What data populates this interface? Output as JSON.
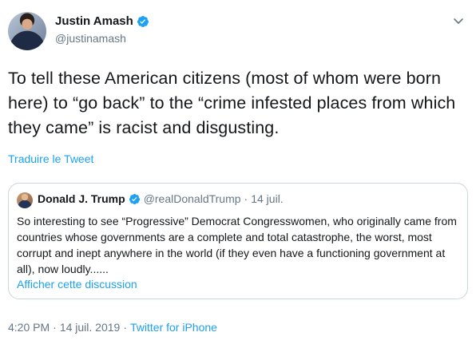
{
  "author": {
    "name": "Justin Amash",
    "handle": "@justinamash"
  },
  "tweet": {
    "text": "To tell these American citizens (most of whom were born here) to “go back” to the “crime infested places from which they came” is racist and disgusting.",
    "translate_label": "Traduire le Tweet"
  },
  "quoted": {
    "name": "Donald J. Trump",
    "handle": "@realDonaldTrump",
    "separator": "·",
    "date": "14 juil.",
    "text": "So interesting to see “Progressive” Democrat Congresswomen, who originally came from countries whose governments are a complete and total catastrophe, the worst, most corrupt and inept anywhere in the world (if they even have a functioning government at all), now loudly......",
    "link_label": "Afficher cette discussion"
  },
  "meta": {
    "time": "4:20 PM",
    "separator": "·",
    "date": "14 juil. 2019",
    "source": "Twitter for iPhone"
  },
  "icons": {
    "verified": "verified-badge-icon",
    "menu": "chevron-down-icon"
  },
  "colors": {
    "accent": "#1da1f2",
    "secondary_text": "#657786",
    "border": "#ccd6dd"
  }
}
